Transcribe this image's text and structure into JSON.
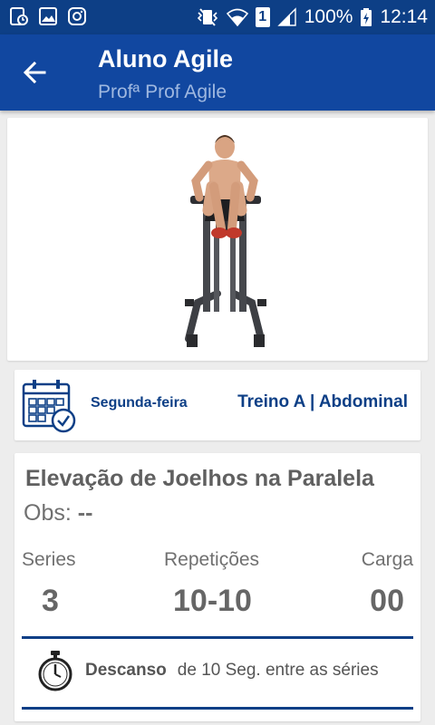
{
  "status_bar": {
    "battery": "100%",
    "time": "12:14",
    "sim_label": "1"
  },
  "header": {
    "title": "Aluno Agile",
    "subtitle": "Profª Prof Agile"
  },
  "schedule": {
    "day": "Segunda-feira",
    "workout": "Treino A | Abdominal"
  },
  "exercise": {
    "name": "Elevação de Joelhos na Paralela",
    "obs_label": "Obs:",
    "obs_value": "--",
    "series_label": "Series",
    "series_value": "3",
    "reps_label": "Repetições",
    "reps_value": "10-10",
    "load_label": "Carga",
    "load_value": "00",
    "rest_label": "Descanso",
    "rest_text": "de 10 Seg.  entre as séries"
  },
  "colors": {
    "primary": "#1147a0",
    "primary_dark": "#0d3f86",
    "accent_text": "#0d3f86"
  }
}
